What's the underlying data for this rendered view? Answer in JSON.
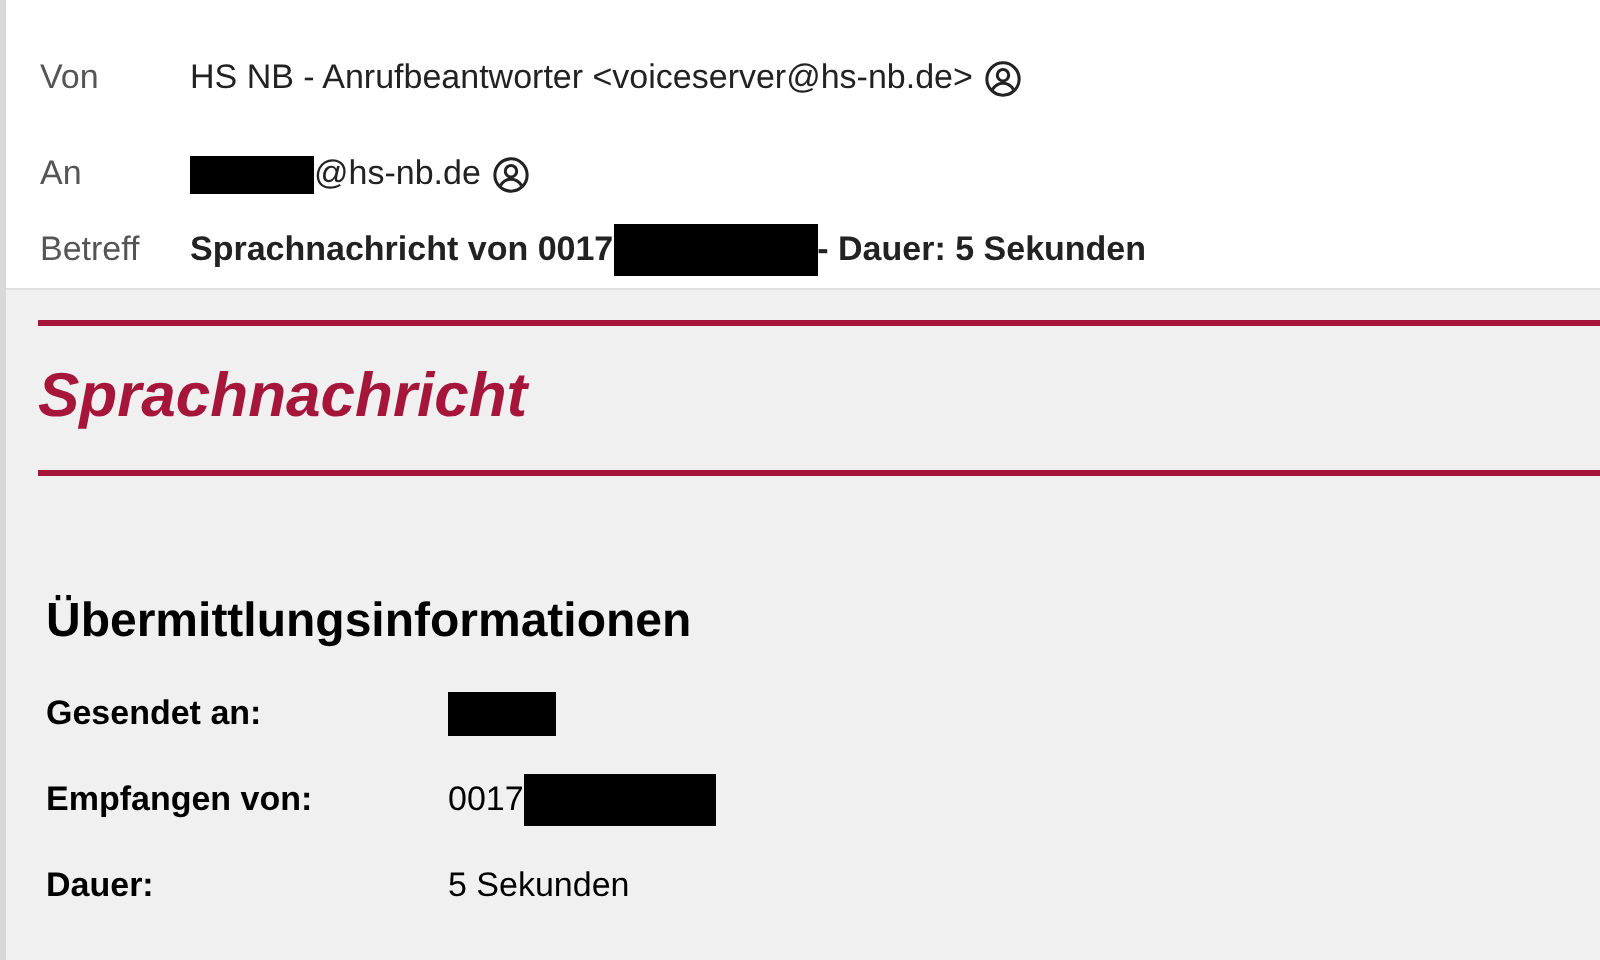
{
  "header": [
    {
      "label": "Von",
      "parts": [
        {
          "kind": "text",
          "text": "HS NB - Anrufbeantworter <voiceserver@hs-nb.de>"
        },
        {
          "kind": "contact"
        }
      ],
      "bold": false
    },
    {
      "label": "An",
      "parts": [
        {
          "kind": "redaction"
        },
        {
          "kind": "text",
          "text": "@hs-nb.de"
        },
        {
          "kind": "contact"
        }
      ],
      "bold": false
    },
    {
      "label": "Betreff",
      "parts": [
        {
          "kind": "text",
          "text": "Sprachnachricht von 0017"
        },
        {
          "kind": "redaction"
        },
        {
          "kind": "text",
          "text": "- Dauer: 5 Sekunden"
        }
      ],
      "bold": true
    }
  ],
  "body": {
    "title": "Sprachnachricht",
    "section": "Übermittlungsinformationen",
    "rows": [
      {
        "label": "Gesendet an:",
        "parts": [
          {
            "kind": "redaction"
          }
        ]
      },
      {
        "label": "Empfangen von:",
        "parts": [
          {
            "kind": "text",
            "text": "0017"
          },
          {
            "kind": "redaction"
          }
        ]
      },
      {
        "label": "Dauer:",
        "parts": [
          {
            "kind": "text",
            "text": "5 Sekunden"
          }
        ]
      }
    ]
  }
}
